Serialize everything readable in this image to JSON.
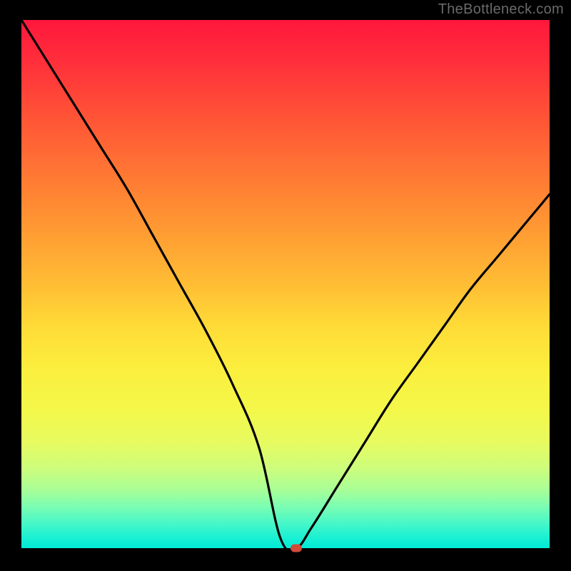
{
  "watermark": "TheBottleneck.com",
  "colors": {
    "curve_stroke": "#000000",
    "dot_fill": "#d24a3a",
    "frame_bg": "#000000"
  },
  "chart_data": {
    "type": "line",
    "title": "",
    "xlabel": "",
    "ylabel": "",
    "xlim": [
      0,
      100
    ],
    "ylim": [
      0,
      100
    ],
    "annotations": [
      {
        "name": "minimum-marker",
        "x": 52,
        "y": 0
      }
    ],
    "series": [
      {
        "name": "bottleneck-curve",
        "x": [
          0,
          5,
          10,
          15,
          20,
          25,
          30,
          35,
          40,
          45,
          49,
          52,
          55,
          60,
          65,
          70,
          75,
          80,
          85,
          90,
          95,
          100
        ],
        "y": [
          100,
          92,
          84,
          76,
          68,
          59,
          50,
          41,
          31,
          19,
          2,
          0,
          4,
          12,
          20,
          28,
          35,
          42,
          49,
          55,
          61,
          67
        ]
      }
    ]
  }
}
